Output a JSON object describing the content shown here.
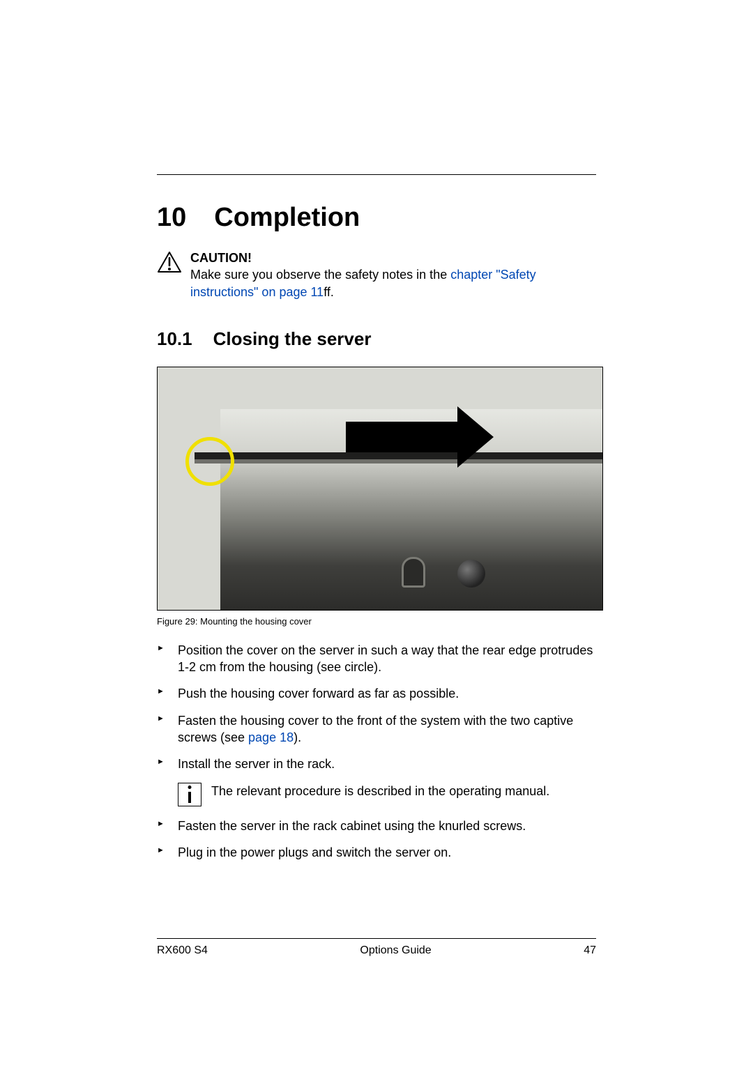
{
  "chapter": {
    "number": "10",
    "title": "Completion"
  },
  "caution": {
    "title": "CAUTION!",
    "text_before_link": "Make sure you observe the safety notes in the ",
    "link_text": "chapter \"Safety instructions\" on page 11",
    "text_after_link": "ff."
  },
  "section": {
    "number": "10.1",
    "title": "Closing the server"
  },
  "figure": {
    "caption": "Figure 29: Mounting the housing cover"
  },
  "steps": [
    {
      "text": "Position the cover on the server in such a way that the rear edge protrudes 1-2 cm from the housing (see circle)."
    },
    {
      "text": "Push the housing cover forward as far as possible."
    },
    {
      "text_before_link": "Fasten the housing cover to the front of the system with the two captive screws (see ",
      "link_text": "page 18",
      "text_after_link": ")."
    },
    {
      "text": "Install the server in the rack."
    }
  ],
  "info": {
    "text": "The relevant procedure is described in the operating manual."
  },
  "steps_after_info": [
    {
      "text": "Fasten the server in the rack cabinet using the knurled screws."
    },
    {
      "text": "Plug in the power plugs and switch the server on."
    }
  ],
  "footer": {
    "left": "RX600 S4",
    "center": "Options Guide",
    "right": "47"
  }
}
